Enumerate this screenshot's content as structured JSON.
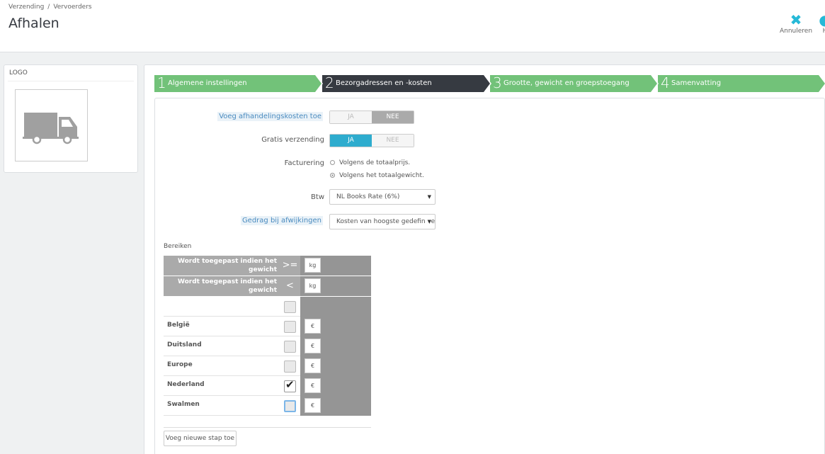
{
  "breadcrumb": [
    "Verzending",
    "Vervoerders"
  ],
  "page_title": "Afhalen",
  "toolbar": {
    "cancel_label": "Annuleren",
    "help_label": "H"
  },
  "logo": {
    "title": "LOGO"
  },
  "steps": [
    {
      "num": "1",
      "label": "Algemene instellingen",
      "state": "done"
    },
    {
      "num": "2",
      "label": "Bezorgadressen en -kosten",
      "state": "active"
    },
    {
      "num": "3",
      "label": "Grootte, gewicht en groepstoegang",
      "state": "todo"
    },
    {
      "num": "4",
      "label": "Samenvatting",
      "state": "todo"
    }
  ],
  "form": {
    "handling_label": "Voeg afhandelingskosten toe",
    "handling_yes": "JA",
    "handling_no": "NEE",
    "handling_value": "NEE",
    "free_label": "Gratis verzending",
    "free_yes": "JA",
    "free_no": "NEE",
    "free_value": "JA",
    "billing_label": "Facturering",
    "billing_opt1": "Volgens de totaalprijs.",
    "billing_opt2": "Volgens het totaalgewicht.",
    "billing_value": "Volgens het totaalgewicht.",
    "tax_label": "Btw",
    "tax_value": "NL Books Rate (6%)",
    "oor_label": "Gedrag bij afwijkingen",
    "oor_value": "Kosten van hoogste gedefinieerd bereik toepassen"
  },
  "ranges": {
    "title": "Bereiken",
    "row_ge": {
      "label": "Wordt toegepast indien het gewicht",
      "op": ">=",
      "unit": "kg"
    },
    "row_lt": {
      "label": "Wordt toegepast indien het gewicht",
      "op": "<",
      "unit": "kg"
    },
    "currency": "€",
    "zones": [
      {
        "name": "België",
        "checked": false
      },
      {
        "name": "Duitsland",
        "checked": false
      },
      {
        "name": "Europe",
        "checked": false
      },
      {
        "name": "Nederland",
        "checked": true
      },
      {
        "name": "Swalmen",
        "checked": false
      }
    ],
    "add_button": "Voeg nieuwe stap toe"
  }
}
